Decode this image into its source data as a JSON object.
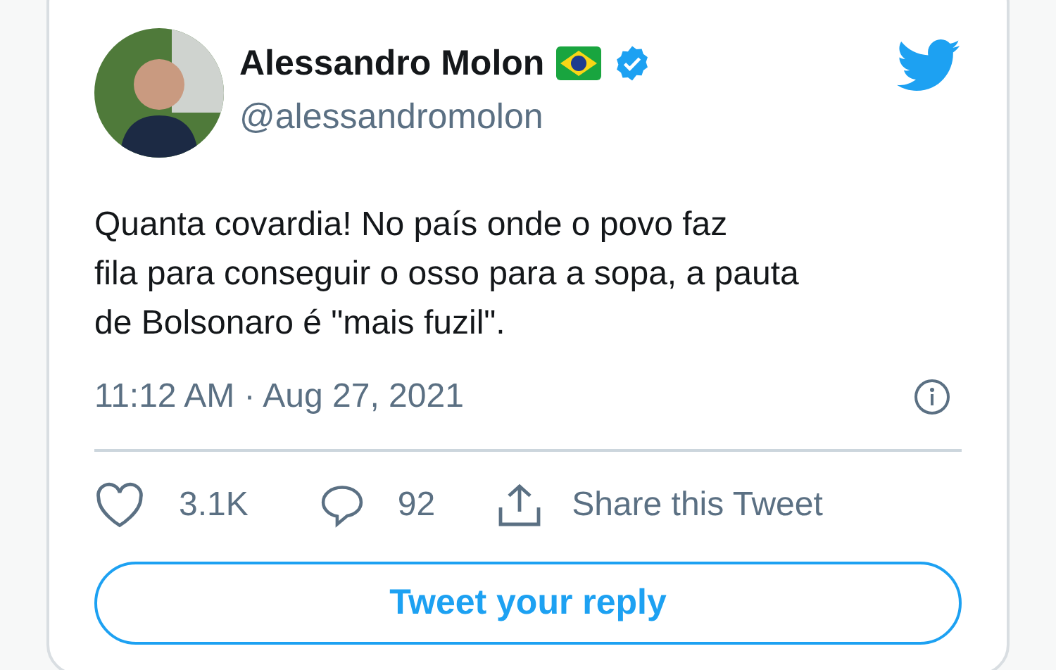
{
  "tweet": {
    "author_name": "Alessandro Molon",
    "handle": "@alessandromolon",
    "text_lines": [
      "Quanta covardia! No país onde o povo faz",
      "fila para conseguir o osso para a sopa, a pauta",
      "de Bolsonaro é \"mais fuzil\"."
    ],
    "timestamp": "11:12 AM · Aug 27, 2021",
    "likes": "3.1K",
    "replies": "92",
    "share_label": "Share this Tweet",
    "reply_button": "Tweet your reply"
  }
}
